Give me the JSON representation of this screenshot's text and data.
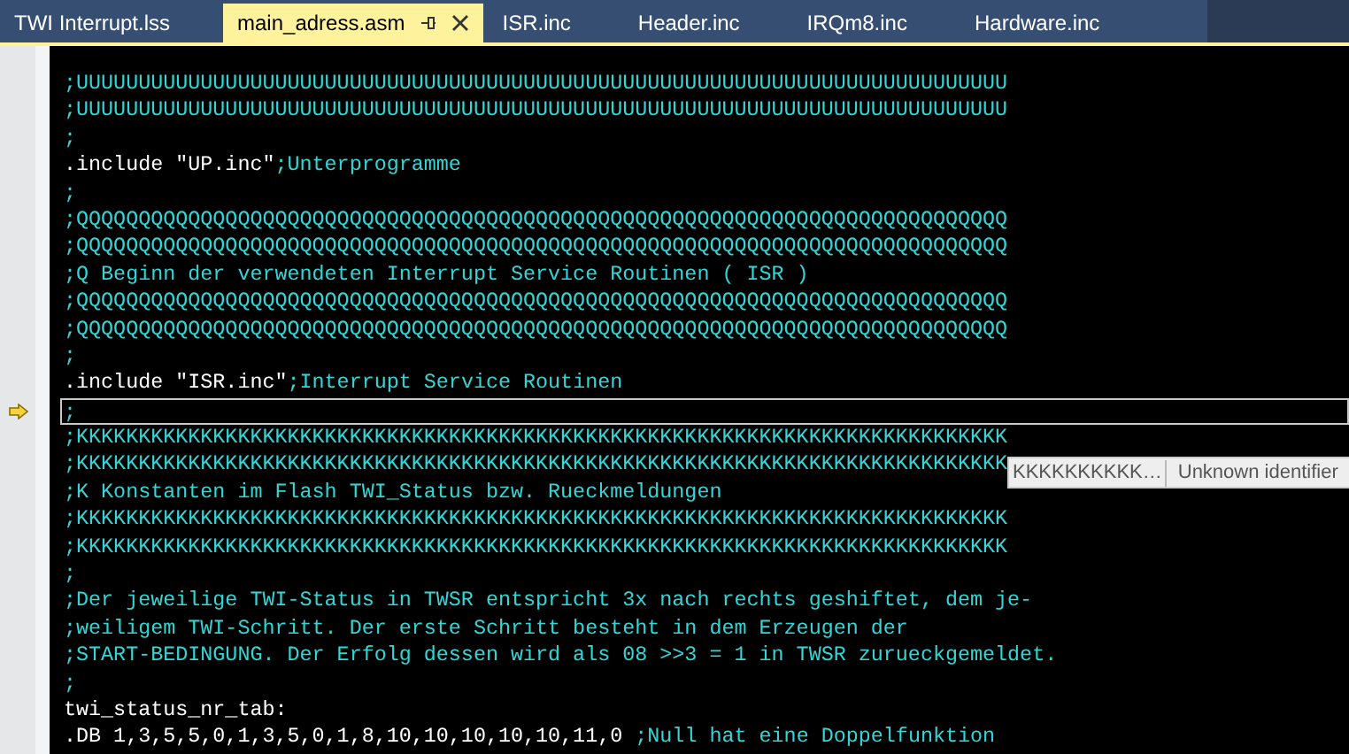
{
  "tabs": [
    {
      "label": "TWI Interrupt.lss",
      "selected": false
    },
    {
      "label": "main_adress.asm",
      "selected": true
    },
    {
      "label": "ISR.inc",
      "selected": false
    },
    {
      "label": "Header.inc",
      "selected": false
    },
    {
      "label": "IRQm8.inc",
      "selected": false
    },
    {
      "label": "Hardware.inc",
      "selected": false
    }
  ],
  "editor": {
    "lines": [
      {
        "comment": ";UUUUUUUUUUUUUUUUUUUUUUUUUUUUUUUUUUUUUUUUUUUUUUUUUUUUUUUUUUUUUUUUUUUUUUUUUUU",
        "current": false
      },
      {
        "comment": ";UUUUUUUUUUUUUUUUUUUUUUUUUUUUUUUUUUUUUUUUUUUUUUUUUUUUUUUUUUUUUUUUUUUUUUUUUUU",
        "current": false
      },
      {
        "comment": ";",
        "current": false
      },
      {
        "code": ".include \"UP.inc\"",
        "comment": ";Unterprogramme",
        "current": false
      },
      {
        "comment": ";",
        "current": false
      },
      {
        "comment": ";QQQQQQQQQQQQQQQQQQQQQQQQQQQQQQQQQQQQQQQQQQQQQQQQQQQQQQQQQQQQQQQQQQQQQQQQQQQ",
        "current": false
      },
      {
        "comment": ";QQQQQQQQQQQQQQQQQQQQQQQQQQQQQQQQQQQQQQQQQQQQQQQQQQQQQQQQQQQQQQQQQQQQQQQQQQQ",
        "current": false
      },
      {
        "comment": ";Q Beginn der verwendeten Interrupt Service Routinen ( ISR )",
        "current": false
      },
      {
        "comment": ";QQQQQQQQQQQQQQQQQQQQQQQQQQQQQQQQQQQQQQQQQQQQQQQQQQQQQQQQQQQQQQQQQQQQQQQQQQQ",
        "current": false
      },
      {
        "comment": ";QQQQQQQQQQQQQQQQQQQQQQQQQQQQQQQQQQQQQQQQQQQQQQQQQQQQQQQQQQQQQQQQQQQQQQQQQQQ",
        "current": false
      },
      {
        "comment": ";",
        "current": false
      },
      {
        "code": ".include \"ISR.inc\"",
        "comment": ";Interrupt Service Routinen",
        "current": false
      },
      {
        "comment": ";",
        "current": true
      },
      {
        "comment": ";KKKKKKKKKKKKKKKKKKKKKKKKKKKKKKKKKKKKKKKKKKKKKKKKKKKKKKKKKKKKKKKKKKKKKKKKKKK",
        "current": false
      },
      {
        "comment": ";KKKKKKKKKKKKKKKKKKKKKKKKKKKKKKKKKKKKKKKKKKKKKKKKKKKKKKKKKKKKKKKKKKKKKKKKKKK",
        "current": false,
        "tooltip": {
          "preview": "KKKKKKKKKK…",
          "message": "Unknown identifier"
        }
      },
      {
        "comment": ";K Konstanten im Flash TWI_Status bzw. Rueckmeldungen",
        "current": false
      },
      {
        "comment": ";KKKKKKKKKKKKKKKKKKKKKKKKKKKKKKKKKKKKKKKKKKKKKKKKKKKKKKKKKKKKKKKKKKKKKKKKKKK",
        "current": false
      },
      {
        "comment": ";KKKKKKKKKKKKKKKKKKKKKKKKKKKKKKKKKKKKKKKKKKKKKKKKKKKKKKKKKKKKKKKKKKKKKKKKKKK",
        "current": false
      },
      {
        "comment": ";",
        "current": false
      },
      {
        "comment": ";Der jeweilige TWI-Status in TWSR entspricht 3x nach rechts geshiftet, dem je-",
        "current": false
      },
      {
        "comment": ";weiligem TWI-Schritt. Der erste Schritt besteht in dem Erzeugen der",
        "current": false
      },
      {
        "comment": ";START-BEDINGUNG. Der Erfolg dessen wird als 08 >>3 = 1 in TWSR zurueckgemeldet.",
        "current": false
      },
      {
        "comment": ";",
        "current": false
      },
      {
        "code": "twi_status_nr_tab:",
        "current": false
      },
      {
        "code": ".DB 1,3,5,5,0,1,3,5,0,1,8,10,10,10,10,10,11,0 ",
        "comment": ";Null hat eine Doppelfunktion",
        "current": false
      }
    ]
  }
}
